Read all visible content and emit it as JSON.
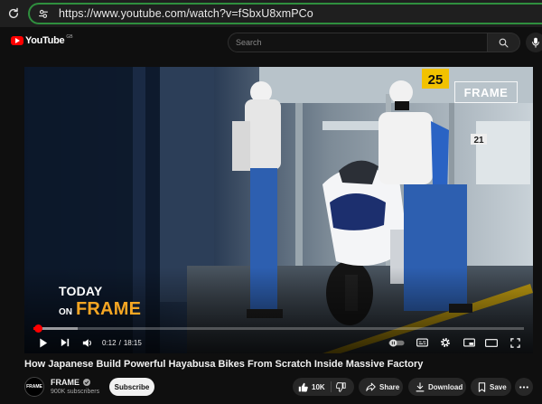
{
  "browser": {
    "url": "https://www.youtube.com/watch?v=fSbxU8xmPCo"
  },
  "masthead": {
    "logo_text": "YouTube",
    "country_code": "GB",
    "search_placeholder": "Search"
  },
  "player": {
    "overlay": {
      "corner_badge": "FRAME",
      "station_number": "25",
      "side_number": "21",
      "today_line": "TODAY",
      "on_word": "ON",
      "brand_word": "FRAME"
    },
    "time_current": "0:12",
    "time_separator": "/",
    "time_total": "18:15",
    "progress_played_fraction": 0.011,
    "progress_buffered_fraction": 0.09
  },
  "video": {
    "title": "How Japanese Build Powerful Hayabusa Bikes From Scratch Inside Massive Factory"
  },
  "channel": {
    "avatar_text": "FRAME",
    "name": "FRAME",
    "subscribers": "900K subscribers",
    "subscribe_label": "Subscribe"
  },
  "actions": {
    "like_count": "10K",
    "share_label": "Share",
    "download_label": "Download",
    "save_label": "Save"
  },
  "colors": {
    "accent_red": "#ff0000",
    "frame_orange": "#f5a623",
    "secure_green": "#2f8f3e"
  }
}
